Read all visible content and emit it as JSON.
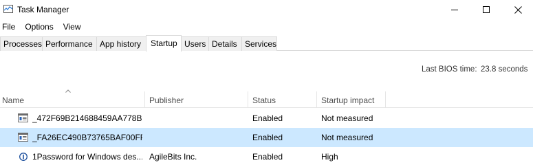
{
  "window": {
    "title": "Task Manager"
  },
  "menu": [
    "File",
    "Options",
    "View"
  ],
  "tabs": [
    "Processes",
    "Performance",
    "App history",
    "Startup",
    "Users",
    "Details",
    "Services"
  ],
  "active_tab": "Startup",
  "bios": {
    "label": "Last BIOS time:",
    "value": "23.8 seconds"
  },
  "columns": [
    "Name",
    "Publisher",
    "Status",
    "Startup impact"
  ],
  "rows": [
    {
      "name": "_472F69B214688459AA778B",
      "publisher": "",
      "status": "Enabled",
      "impact": "Not measured",
      "icon": "app-window-icon"
    },
    {
      "name": "_FA26EC490B73765BAF00FF",
      "publisher": "",
      "status": "Enabled",
      "impact": "Not measured",
      "icon": "app-window-icon"
    },
    {
      "name": "1Password for Windows des...",
      "publisher": "AgileBits Inc.",
      "status": "Enabled",
      "impact": "High",
      "icon": "1password-icon"
    }
  ],
  "colors": {
    "selected_row": "#cce8ff",
    "border": "#d9d9d9"
  }
}
